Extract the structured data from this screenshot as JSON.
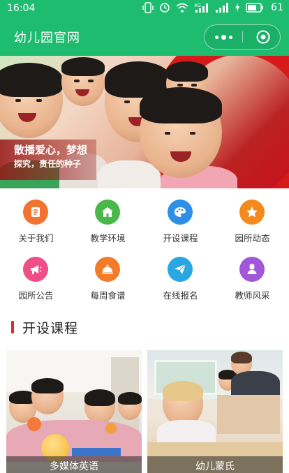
{
  "status_bar": {
    "time": "16:04",
    "battery": "61",
    "icons": [
      "vibrate-icon",
      "alarm-icon",
      "wifi-icon",
      "signal-4g-icon",
      "signal-icon",
      "charging-icon",
      "battery-icon"
    ]
  },
  "nav": {
    "title": "幼儿园官网",
    "background": "#1dbc6f"
  },
  "banner": {
    "line1": "散播爱心，梦想",
    "line2": "探究，责任的种子"
  },
  "menu": [
    {
      "label": "关于我们",
      "icon": "document-icon",
      "color": "#f2722f"
    },
    {
      "label": "教学环境",
      "icon": "school-icon",
      "color": "#49b84a"
    },
    {
      "label": "开设课程",
      "icon": "palette-icon",
      "color": "#2f8ee6"
    },
    {
      "label": "园所动态",
      "icon": "star-icon",
      "color": "#f48a1c"
    },
    {
      "label": "园所公告",
      "icon": "megaphone-icon",
      "color": "#ef4f86"
    },
    {
      "label": "每周食谱",
      "icon": "food-cloche-icon",
      "color": "#f17c2a"
    },
    {
      "label": "在线报名",
      "icon": "paper-plane-icon",
      "color": "#2aa7e2"
    },
    {
      "label": "教师风采",
      "icon": "teacher-icon",
      "color": "#a257d8"
    }
  ],
  "section": {
    "title": "开设课程",
    "accent": "#d43030"
  },
  "courses": [
    {
      "caption": "多媒体英语"
    },
    {
      "caption": "幼儿蒙氏"
    }
  ]
}
